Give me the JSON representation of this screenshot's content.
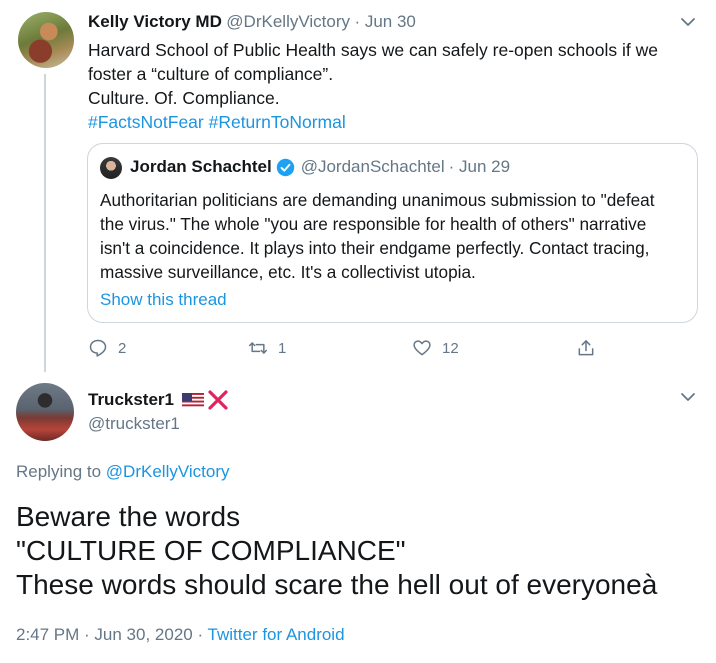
{
  "parent_tweet": {
    "author_name": "Kelly Victory MD",
    "author_handle": "@DrKellyVictory",
    "date": "· Jun 30",
    "line1": "Harvard School of Public Health says we can safely re-open schools if we",
    "line2": "foster a “culture of compliance”.",
    "line3": "Culture. Of. Compliance.",
    "hashtags": "#FactsNotFear #ReturnToNormal",
    "quote": {
      "author_name": "Jordan Schachtel",
      "author_handle": "@JordanSchachtel",
      "date": "· Jun 29",
      "lines": [
        "Authoritarian politicians are demanding unanimous submission to \"defeat",
        "the virus.\" The whole \"you are responsible for health of others\" narrative",
        "isn't a coincidence. It plays into their endgame perfectly. Contact tracing,",
        "massive surveillance, etc. It's a collectivist utopia."
      ],
      "show_thread": "Show this thread"
    },
    "actions": {
      "replies": "2",
      "retweets": "1",
      "likes": "12"
    }
  },
  "reply_tweet": {
    "author_name": "Truckster1",
    "author_handle": "@truckster1",
    "replying_prefix": "Replying to",
    "replying_to": "@DrKellyVictory",
    "lines": [
      "Beware the words",
      "\"CULTURE OF COMPLIANCE\"",
      "These words should scare the hell out of everyoneà"
    ],
    "timestamp": "2:47 PM · Jun 30, 2020 ·",
    "source": "Twitter for Android"
  },
  "colors": {
    "link": "#1b95e0",
    "muted": "#657786",
    "border": "#ccd6dd",
    "red_x": "#e0245e"
  }
}
